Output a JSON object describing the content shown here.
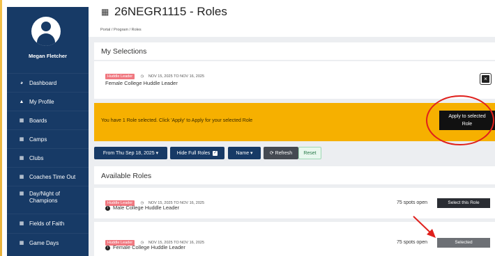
{
  "profile": {
    "name": "Megan Fletcher"
  },
  "sidebar": {
    "items": [
      {
        "label": "Dashboard",
        "icon": "dashboard-icon",
        "glyph": "◕"
      },
      {
        "label": "My Profile",
        "icon": "user-icon",
        "glyph": "▲"
      },
      {
        "label": "Boards",
        "icon": "calendar-icon",
        "glyph": "▦"
      },
      {
        "label": "Camps",
        "icon": "calendar-icon",
        "glyph": "▦"
      },
      {
        "label": "Clubs",
        "icon": "calendar-icon",
        "glyph": "▦"
      },
      {
        "label": "Coaches Time Out",
        "icon": "calendar-icon",
        "glyph": "▦"
      },
      {
        "label": "Day/Night of Champions",
        "icon": "calendar-icon",
        "glyph": "▦"
      },
      {
        "label": "Fields of Faith",
        "icon": "calendar-icon",
        "glyph": "▦"
      },
      {
        "label": "Game Days",
        "icon": "calendar-icon",
        "glyph": "▦"
      }
    ]
  },
  "header": {
    "title": "26NEGR1115 - Roles",
    "breadcrumb": "Portal / Program / Roles"
  },
  "my_selections": {
    "heading": "My Selections",
    "item": {
      "badge": "Huddle Leader",
      "dates": "NOV 15, 2025 TO NOV 16, 2025",
      "role": "Female College Huddle Leader"
    }
  },
  "alert": {
    "message": "You have 1 Role selected. Click 'Apply' to Apply for your selected Role",
    "apply_label_line1": "Apply to selected",
    "apply_label_line2": "Role"
  },
  "filters": {
    "date": "From Thu Sep 18, 2025 ▾",
    "hide_full": "Hide Full Roles",
    "hide_full_check": "✓",
    "name": "Name ▾",
    "refresh": "⟳ Refresh",
    "reset": "Reset"
  },
  "available": {
    "heading": "Available Roles",
    "roles": [
      {
        "badge": "Huddle Leader",
        "dates": "NOV 15, 2025 TO NOV 16, 2025",
        "role": "Male College Huddle Leader",
        "spots": "75 spots open",
        "button": "Select this Role"
      },
      {
        "badge": "Huddle Leader",
        "dates": "NOV 15, 2025 TO NOV 16, 2025",
        "role": "Female College Huddle Leader",
        "spots": "75 spots open",
        "button": "Selected"
      }
    ]
  },
  "colors": {
    "sidebar": "#173a66",
    "alert": "#f6b000",
    "badge": "#f07880",
    "annotation": "#e0201c"
  }
}
